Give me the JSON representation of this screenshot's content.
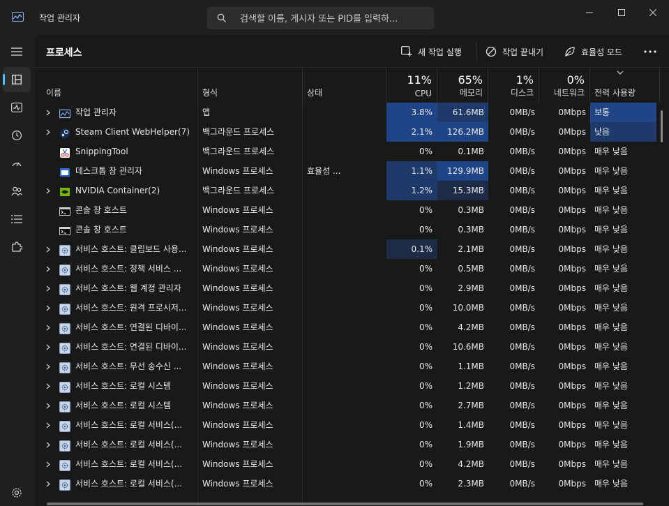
{
  "app": {
    "title": "작업 관리자"
  },
  "search": {
    "placeholder": "검색할 이름, 게시자 또는 PID를 입력하..."
  },
  "toolbar": {
    "page_title": "프로세스",
    "new_task": "새 작업 실행",
    "end_task": "작업 끝내기",
    "efficiency": "효율성 모드"
  },
  "columns": {
    "name": "이름",
    "type": "형식",
    "status": "상태",
    "cpu_pct": "11%",
    "cpu": "CPU",
    "mem_pct": "65%",
    "mem": "메모리",
    "disk_pct": "1%",
    "disk": "디스크",
    "net_pct": "0%",
    "net": "네트워크",
    "power": "전력 사용량"
  },
  "rows": [
    {
      "name": "작업 관리자",
      "type": "앱",
      "status": "",
      "cpu": "3.8%",
      "mem": "61.6MB",
      "disk": "0MB/s",
      "net": "0Mbps",
      "power": "보통",
      "expand": true,
      "icon": "taskmgr-icon"
    },
    {
      "name": "Steam Client WebHelper(7)",
      "type": "백그라운드 프로세스",
      "status": "",
      "cpu": "2.1%",
      "mem": "126.2MB",
      "disk": "0MB/s",
      "net": "0Mbps",
      "power": "낮음",
      "expand": true,
      "icon": "steam-icon"
    },
    {
      "name": "SnippingTool",
      "type": "백그라운드 프로세스",
      "status": "",
      "cpu": "0%",
      "mem": "0.1MB",
      "disk": "0MB/s",
      "net": "0Mbps",
      "power": "매우 낮음",
      "expand": false,
      "icon": "snipping-icon"
    },
    {
      "name": "데스크톱 창 관리자",
      "type": "Windows 프로세스",
      "status": "효율성 ...",
      "cpu": "1.1%",
      "mem": "129.9MB",
      "disk": "0MB/s",
      "net": "0Mbps",
      "power": "매우 낮음",
      "expand": false,
      "icon": "dwm-icon"
    },
    {
      "name": "NVIDIA Container(2)",
      "type": "백그라운드 프로세스",
      "status": "",
      "cpu": "1.2%",
      "mem": "15.3MB",
      "disk": "0MB/s",
      "net": "0Mbps",
      "power": "매우 낮음",
      "expand": true,
      "icon": "nvidia-icon"
    },
    {
      "name": "콘솔 창 호스트",
      "type": "Windows 프로세스",
      "status": "",
      "cpu": "0%",
      "mem": "0.3MB",
      "disk": "0MB/s",
      "net": "0Mbps",
      "power": "매우 낮음",
      "expand": false,
      "icon": "console-icon"
    },
    {
      "name": "콘솔 창 호스트",
      "type": "Windows 프로세스",
      "status": "",
      "cpu": "0%",
      "mem": "0.3MB",
      "disk": "0MB/s",
      "net": "0Mbps",
      "power": "매우 낮음",
      "expand": false,
      "icon": "console-icon"
    },
    {
      "name": "서비스 호스트: 클립보드 사용...",
      "type": "Windows 프로세스",
      "status": "",
      "cpu": "0.1%",
      "mem": "2.1MB",
      "disk": "0MB/s",
      "net": "0Mbps",
      "power": "매우 낮음",
      "expand": true,
      "icon": "gear-icon"
    },
    {
      "name": "서비스 호스트: 정책 서비스 ...",
      "type": "Windows 프로세스",
      "status": "",
      "cpu": "0%",
      "mem": "0.5MB",
      "disk": "0MB/s",
      "net": "0Mbps",
      "power": "매우 낮음",
      "expand": true,
      "icon": "gear-icon"
    },
    {
      "name": "서비스 호스트: 웹 계정 관리자",
      "type": "Windows 프로세스",
      "status": "",
      "cpu": "0%",
      "mem": "2.9MB",
      "disk": "0MB/s",
      "net": "0Mbps",
      "power": "매우 낮음",
      "expand": true,
      "icon": "gear-icon"
    },
    {
      "name": "서비스 호스트: 원격 프로시저...",
      "type": "Windows 프로세스",
      "status": "",
      "cpu": "0%",
      "mem": "10.0MB",
      "disk": "0MB/s",
      "net": "0Mbps",
      "power": "매우 낮음",
      "expand": true,
      "icon": "gear-icon"
    },
    {
      "name": "서비스 호스트: 연결된 디바이...",
      "type": "Windows 프로세스",
      "status": "",
      "cpu": "0%",
      "mem": "4.2MB",
      "disk": "0MB/s",
      "net": "0Mbps",
      "power": "매우 낮음",
      "expand": true,
      "icon": "gear-icon"
    },
    {
      "name": "서비스 호스트: 연결된 디바이...",
      "type": "Windows 프로세스",
      "status": "",
      "cpu": "0%",
      "mem": "10.6MB",
      "disk": "0MB/s",
      "net": "0Mbps",
      "power": "매우 낮음",
      "expand": true,
      "icon": "gear-icon"
    },
    {
      "name": "서비스 호스트: 무선 송수신 ...",
      "type": "Windows 프로세스",
      "status": "",
      "cpu": "0%",
      "mem": "1.1MB",
      "disk": "0MB/s",
      "net": "0Mbps",
      "power": "매우 낮음",
      "expand": true,
      "icon": "gear-icon"
    },
    {
      "name": "서비스 호스트: 로컬 시스템",
      "type": "Windows 프로세스",
      "status": "",
      "cpu": "0%",
      "mem": "1.2MB",
      "disk": "0MB/s",
      "net": "0Mbps",
      "power": "매우 낮음",
      "expand": true,
      "icon": "gear-icon"
    },
    {
      "name": "서비스 호스트: 로컬 시스템",
      "type": "Windows 프로세스",
      "status": "",
      "cpu": "0%",
      "mem": "2.7MB",
      "disk": "0MB/s",
      "net": "0Mbps",
      "power": "매우 낮음",
      "expand": true,
      "icon": "gear-icon"
    },
    {
      "name": "서비스 호스트: 로컬 서비스(...",
      "type": "Windows 프로세스",
      "status": "",
      "cpu": "0%",
      "mem": "1.4MB",
      "disk": "0MB/s",
      "net": "0Mbps",
      "power": "매우 낮음",
      "expand": true,
      "icon": "gear-icon"
    },
    {
      "name": "서비스 호스트: 로컬 서비스(...",
      "type": "Windows 프로세스",
      "status": "",
      "cpu": "0%",
      "mem": "1.9MB",
      "disk": "0MB/s",
      "net": "0Mbps",
      "power": "매우 낮음",
      "expand": true,
      "icon": "gear-icon"
    },
    {
      "name": "서비스 호스트: 로컬 서비스(...",
      "type": "Windows 프로세스",
      "status": "",
      "cpu": "0%",
      "mem": "4.2MB",
      "disk": "0MB/s",
      "net": "0Mbps",
      "power": "매우 낮음",
      "expand": true,
      "icon": "gear-icon"
    },
    {
      "name": "서비스 호스트: 로컬 서비스(...",
      "type": "Windows 프로세스",
      "status": "",
      "cpu": "0%",
      "mem": "2.3MB",
      "disk": "0MB/s",
      "net": "0Mbps",
      "power": "매우 낮음",
      "expand": true,
      "icon": "gear-icon"
    }
  ],
  "colors": {
    "accent": "#4cc2ff",
    "heat_high": "#1f4587",
    "heat_mid": "#1d3a6b",
    "heat_low": "#1d2b46"
  }
}
